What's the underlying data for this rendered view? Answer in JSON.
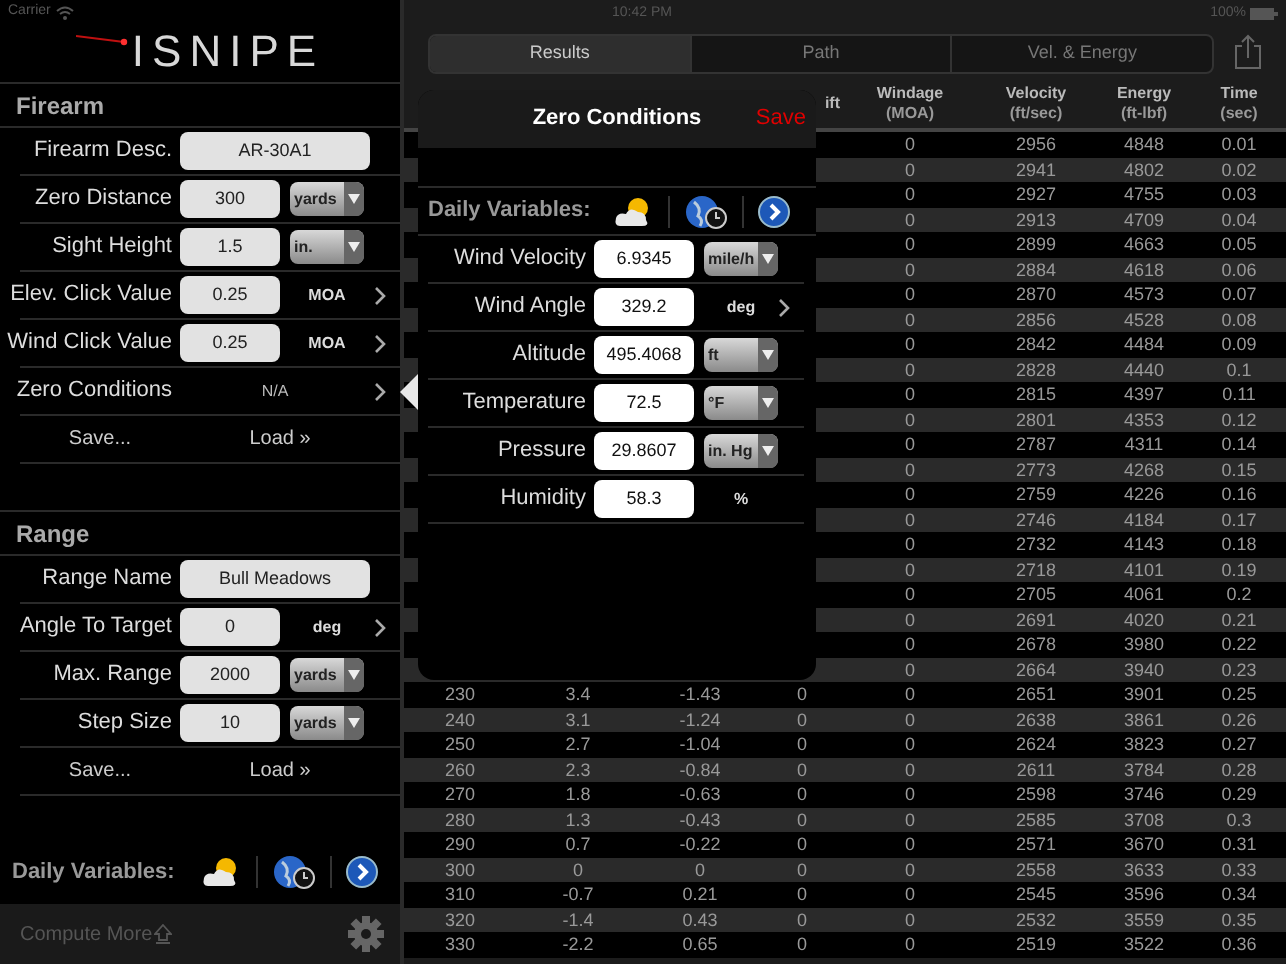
{
  "status_bar": {
    "carrier": "Carrier",
    "time": "10:42 PM",
    "battery": "100%"
  },
  "logo": "ISNIPE",
  "sections": [
    {
      "title": "Firearm",
      "rows": [
        {
          "kind": "text_field",
          "label": "Firearm Desc.",
          "value": "AR-30A1"
        },
        {
          "kind": "unit_field",
          "label": "Zero Distance",
          "value": "300",
          "unit": "yards"
        },
        {
          "kind": "unit_field",
          "label": "Sight Height",
          "value": "1.5",
          "unit": "in."
        },
        {
          "kind": "link_field",
          "label": "Elev. Click Value",
          "value": "0.25",
          "unit": "MOA"
        },
        {
          "kind": "link_field",
          "label": "Wind Click Value",
          "value": "0.25",
          "unit": "MOA"
        },
        {
          "kind": "link",
          "label": "Zero Conditions",
          "value": "N/A"
        }
      ],
      "actions": [
        "Save...",
        "Load »"
      ]
    },
    {
      "title": "Range",
      "rows": [
        {
          "kind": "text_field",
          "label": "Range Name",
          "value": "Bull Meadows"
        },
        {
          "kind": "link_field",
          "label": "Angle To Target",
          "value": "0",
          "unit": "deg"
        },
        {
          "kind": "unit_field",
          "label": "Max. Range",
          "value": "2000",
          "unit": "yards"
        },
        {
          "kind": "unit_field",
          "label": "Step Size",
          "value": "10",
          "unit": "yards"
        }
      ],
      "actions": [
        "Save...",
        "Load »"
      ]
    }
  ],
  "daily_variables": {
    "label": "Daily Variables:"
  },
  "bottom_bar": {
    "label": "Compute More"
  },
  "tabs": [
    {
      "label": "Results",
      "selected": true
    },
    {
      "label": "Path",
      "selected": false
    },
    {
      "label": "Vel. & Energy",
      "selected": false
    }
  ],
  "popover": {
    "title": "Zero Conditions",
    "save": "Save",
    "daily_label": "Daily Variables:",
    "rows": [
      {
        "kind": "unit_field",
        "label": "Wind Velocity",
        "value": "6.9345",
        "unit": "mile/h"
      },
      {
        "kind": "link_field",
        "label": "Wind Angle",
        "value": "329.2",
        "unit": "deg"
      },
      {
        "kind": "unit_field",
        "label": "Altitude",
        "value": "495.4068",
        "unit": "ft"
      },
      {
        "kind": "unit_field",
        "label": "Temperature",
        "value": "72.5",
        "unit": "°F"
      },
      {
        "kind": "unit_field",
        "label": "Pressure",
        "value": "29.8607",
        "unit": "in. Hg"
      },
      {
        "kind": "plain_field",
        "label": "Humidity",
        "value": "58.3",
        "unit": "%"
      }
    ]
  },
  "table": {
    "columns": [
      {},
      {},
      {},
      {
        "title": "ift"
      },
      {
        "title": "Windage",
        "unit": "(MOA)"
      },
      {
        "title": "Velocity",
        "unit": "(ft/sec)"
      },
      {
        "title": "Energy",
        "unit": "(ft-lbf)"
      },
      {
        "title": "Time",
        "unit": "(sec)"
      }
    ],
    "rows": [
      [
        "",
        "",
        "",
        "",
        "0",
        "2956",
        "4848",
        "0.01"
      ],
      [
        "",
        "",
        "",
        "",
        "0",
        "2941",
        "4802",
        "0.02"
      ],
      [
        "",
        "",
        "",
        "",
        "0",
        "2927",
        "4755",
        "0.03"
      ],
      [
        "",
        "",
        "",
        "",
        "0",
        "2913",
        "4709",
        "0.04"
      ],
      [
        "",
        "",
        "",
        "",
        "0",
        "2899",
        "4663",
        "0.05"
      ],
      [
        "",
        "",
        "",
        "",
        "0",
        "2884",
        "4618",
        "0.06"
      ],
      [
        "",
        "",
        "",
        "",
        "0",
        "2870",
        "4573",
        "0.07"
      ],
      [
        "",
        "",
        "",
        "",
        "0",
        "2856",
        "4528",
        "0.08"
      ],
      [
        "",
        "",
        "",
        "",
        "0",
        "2842",
        "4484",
        "0.09"
      ],
      [
        "",
        "",
        "",
        "",
        "0",
        "2828",
        "4440",
        "0.1"
      ],
      [
        "",
        "",
        "",
        "",
        "0",
        "2815",
        "4397",
        "0.11"
      ],
      [
        "",
        "",
        "",
        "",
        "0",
        "2801",
        "4353",
        "0.12"
      ],
      [
        "",
        "",
        "",
        "",
        "0",
        "2787",
        "4311",
        "0.14"
      ],
      [
        "",
        "",
        "",
        "",
        "0",
        "2773",
        "4268",
        "0.15"
      ],
      [
        "",
        "",
        "",
        "",
        "0",
        "2759",
        "4226",
        "0.16"
      ],
      [
        "",
        "",
        "",
        "",
        "0",
        "2746",
        "4184",
        "0.17"
      ],
      [
        "",
        "",
        "",
        "",
        "0",
        "2732",
        "4143",
        "0.18"
      ],
      [
        "",
        "",
        "",
        "",
        "0",
        "2718",
        "4101",
        "0.19"
      ],
      [
        "",
        "",
        "",
        "",
        "0",
        "2705",
        "4061",
        "0.2"
      ],
      [
        "",
        "",
        "",
        "",
        "0",
        "2691",
        "4020",
        "0.21"
      ],
      [
        "",
        "",
        "",
        "",
        "0",
        "2678",
        "3980",
        "0.22"
      ],
      [
        "",
        "",
        "",
        "",
        "0",
        "2664",
        "3940",
        "0.23"
      ],
      [
        "230",
        "3.4",
        "-1.43",
        "0",
        "0",
        "2651",
        "3901",
        "0.25"
      ],
      [
        "240",
        "3.1",
        "-1.24",
        "0",
        "0",
        "2638",
        "3861",
        "0.26"
      ],
      [
        "250",
        "2.7",
        "-1.04",
        "0",
        "0",
        "2624",
        "3823",
        "0.27"
      ],
      [
        "260",
        "2.3",
        "-0.84",
        "0",
        "0",
        "2611",
        "3784",
        "0.28"
      ],
      [
        "270",
        "1.8",
        "-0.63",
        "0",
        "0",
        "2598",
        "3746",
        "0.29"
      ],
      [
        "280",
        "1.3",
        "-0.43",
        "0",
        "0",
        "2585",
        "3708",
        "0.3"
      ],
      [
        "290",
        "0.7",
        "-0.22",
        "0",
        "0",
        "2571",
        "3670",
        "0.31"
      ],
      [
        "300",
        "0",
        "0",
        "0",
        "0",
        "2558",
        "3633",
        "0.33"
      ],
      [
        "310",
        "-0.7",
        "0.21",
        "0",
        "0",
        "2545",
        "3596",
        "0.34"
      ],
      [
        "320",
        "-1.4",
        "0.43",
        "0",
        "0",
        "2532",
        "3559",
        "0.35"
      ],
      [
        "330",
        "-2.2",
        "0.65",
        "0",
        "0",
        "2519",
        "3522",
        "0.36"
      ]
    ]
  }
}
